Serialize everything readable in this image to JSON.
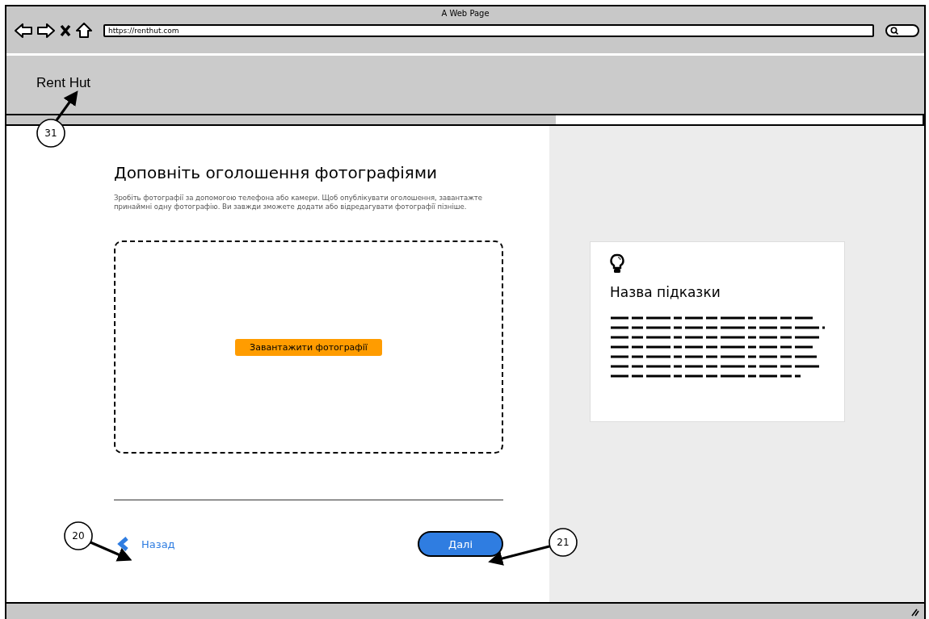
{
  "browser": {
    "title": "A Web Page",
    "url": "https://renthut.com"
  },
  "header": {
    "logo": "Rent Hut"
  },
  "progress": {
    "level": 0.6
  },
  "main": {
    "heading": "Доповніть оголошення фотографіями",
    "description": "Зробіть фотографії за допомогою телефона або камери. Щоб опублікувати оголошення, завантажте принаймні одну фотографію. Ви завжди зможете додати або відредагувати фотографії пізніше.",
    "upload_button": "Завантажити фотографії"
  },
  "nav": {
    "back": "Назад",
    "next": "Далі"
  },
  "tip": {
    "title": "Назва підказки"
  },
  "callouts": [
    {
      "number": "31"
    },
    {
      "number": "20"
    },
    {
      "number": "21"
    }
  ]
}
